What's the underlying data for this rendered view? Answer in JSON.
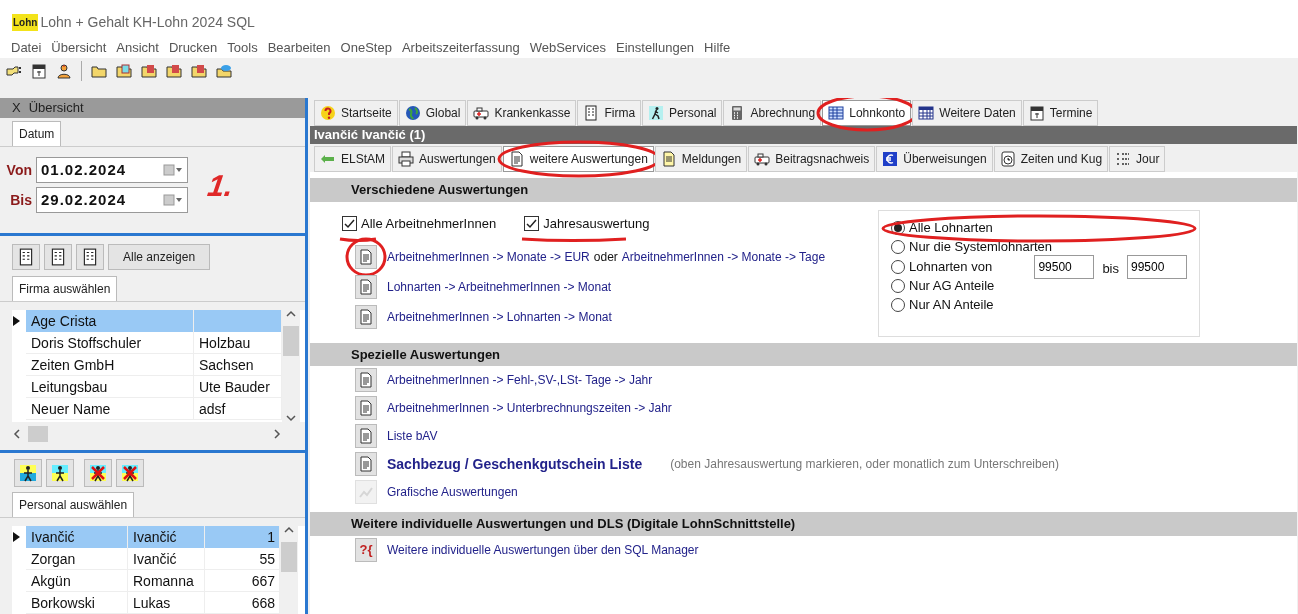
{
  "window": {
    "logo": "Lohn",
    "title": "Lohn + Gehalt KH-Lohn 2024 SQL"
  },
  "menu": [
    "Datei",
    "Übersicht",
    "Ansicht",
    "Drucken",
    "Tools",
    "Bearbeiten",
    "OneStep",
    "Arbeitszeiterfassung",
    "WebServices",
    "Einstellungen",
    "Hilfe"
  ],
  "left_panel": {
    "header": {
      "close": "X",
      "title": "Übersicht"
    },
    "date_tab": {
      "label": "Datum",
      "selected": true
    },
    "from": {
      "label": "Von",
      "value": "01.02.2024"
    },
    "to": {
      "label": "Bis",
      "value": "29.02.2024"
    },
    "annotation": "1.",
    "show_all_button": "Alle anzeigen",
    "company_tab": {
      "label": "Firma auswählen",
      "selected": true
    },
    "company_rows": [
      {
        "name": "Age Crista",
        "column_2": "",
        "selected": true
      },
      {
        "name": "Doris Stoffschuler",
        "column_2": "Holzbau",
        "selected": false
      },
      {
        "name": "Zeiten GmbH",
        "column_2": "Sachsen",
        "selected": false
      },
      {
        "name": "Leitungsbau",
        "column_2": "Ute Bauder",
        "selected": false
      },
      {
        "name": "Neuer Name",
        "column_2": "adsf",
        "selected": false
      }
    ],
    "person_tab": {
      "label": "Personal auswählen",
      "selected": true
    },
    "person_rows": [
      {
        "name": "Ivančić",
        "column_2": "Ivančić",
        "column_3": "1",
        "selected": true
      },
      {
        "name": "Zorgan",
        "column_2": "Ivančić",
        "column_3": "55",
        "selected": false
      },
      {
        "name": "Akgün",
        "column_2": "Romanna",
        "column_3": "667",
        "selected": false
      },
      {
        "name": "Borkowski",
        "column_2": "Lukas",
        "column_3": "668",
        "selected": false
      }
    ]
  },
  "top_tabs": [
    {
      "label": "Startseite",
      "kind": "help",
      "selected": false,
      "circled": false
    },
    {
      "label": "Global",
      "kind": "globe",
      "selected": false,
      "circled": false
    },
    {
      "label": "Krankenkasse",
      "kind": "ambulance",
      "selected": false,
      "circled": false
    },
    {
      "label": "Firma",
      "kind": "building",
      "selected": false,
      "circled": false
    },
    {
      "label": "Personal",
      "kind": "walker",
      "selected": false,
      "circled": false
    },
    {
      "label": "Abrechnung",
      "kind": "calculator",
      "selected": false,
      "circled": false
    },
    {
      "label": "Lohnkonto",
      "kind": "table",
      "selected": true,
      "circled": true
    },
    {
      "label": "Weitere Daten",
      "kind": "grid",
      "selected": false,
      "circled": false
    },
    {
      "label": "Termine",
      "kind": "calendar",
      "selected": false,
      "circled": false
    }
  ],
  "employee_header": "Ivančić Ivančić (1)",
  "sub_tabs": [
    {
      "label": "ELStAM",
      "kind": "arrows",
      "selected": false,
      "circled": false
    },
    {
      "label": "Auswertungen",
      "kind": "printer",
      "selected": false,
      "circled": false
    },
    {
      "label": "weitere Auswertungen",
      "kind": "document",
      "selected": true,
      "circled": true
    },
    {
      "label": "Meldungen",
      "kind": "note",
      "selected": false,
      "circled": false
    },
    {
      "label": "Beitragsnachweis",
      "kind": "ambulance",
      "selected": false,
      "circled": false
    },
    {
      "label": "Überweisungen",
      "kind": "money",
      "selected": false,
      "circled": false
    },
    {
      "label": "Zeiten und Kug",
      "kind": "clock",
      "selected": false,
      "circled": false
    },
    {
      "label": "Jour",
      "kind": "list",
      "selected": false,
      "circled": false
    }
  ],
  "sections": [
    {
      "title": "Verschiedene Auswertungen",
      "checkboxes": [
        {
          "label": "Alle ArbeitnehmerInnen",
          "checked": true,
          "underlined": true
        },
        {
          "label": "Jahresauswertung",
          "checked": true,
          "underlined": true
        }
      ],
      "reports": [
        {
          "kind": "document",
          "circled": true,
          "parts": [
            {
              "text": "ArbeitnehmerInnen -> Monate -> EUR",
              "kind": "link"
            },
            {
              "text": "oder",
              "kind": "plain"
            },
            {
              "text": "ArbeitnehmerInnen -> Monate -> Tage",
              "kind": "link"
            }
          ]
        },
        {
          "kind": "document",
          "circled": false,
          "parts": [
            {
              "text": "Lohnarten -> ArbeitnehmerInnen -> Monat",
              "kind": "link"
            }
          ]
        },
        {
          "kind": "document",
          "circled": false,
          "parts": [
            {
              "text": "ArbeitnehmerInnen -> Lohnarten -> Monat",
              "kind": "link"
            }
          ]
        }
      ],
      "radio_options": [
        {
          "label": "Alle Lohnarten",
          "selected": true,
          "circled": true
        },
        {
          "label": "Nur die Systemlohnarten",
          "selected": false,
          "circled": false
        },
        {
          "label": "Lohnarten von",
          "selected": false,
          "circled": false,
          "range": {
            "from": "99500",
            "joiner": "bis",
            "to": "99500"
          }
        },
        {
          "label": "Nur AG Anteile",
          "selected": false,
          "circled": false
        },
        {
          "label": "Nur AN Anteile",
          "selected": false,
          "circled": false
        }
      ]
    },
    {
      "title": "Spezielle Auswertungen",
      "reports": [
        {
          "kind": "document",
          "circled": false,
          "parts": [
            {
              "text": "ArbeitnehmerInnen -> Fehl-,SV-,LSt- Tage -> Jahr",
              "kind": "link"
            }
          ]
        },
        {
          "kind": "document",
          "circled": false,
          "parts": [
            {
              "text": "ArbeitnehmerInnen -> Unterbrechnungszeiten -> Jahr",
              "kind": "link"
            }
          ]
        },
        {
          "kind": "document",
          "circled": false,
          "parts": [
            {
              "text": "Liste bAV",
              "kind": "link"
            }
          ]
        },
        {
          "kind": "document",
          "circled": false,
          "parts": [
            {
              "text": "Sachbezug / Geschenkgutschein Liste",
              "kind": "strong"
            },
            {
              "text": "(oben Jahresauswertung markieren, oder monatlich zum Unterschreiben)",
              "kind": "note"
            }
          ]
        },
        {
          "kind": "chart",
          "circled": false,
          "parts": [
            {
              "text": "Grafische Auswertungen",
              "kind": "link"
            }
          ]
        }
      ]
    },
    {
      "title": "Weitere individuelle Auswertungen und DLS  (Digitale LohnSchnittstelle)",
      "reports": [
        {
          "kind": "sql",
          "icon_text": "?{",
          "circled": false,
          "parts": [
            {
              "text": "Weitere individuelle Auswertungen über den SQL Manager",
              "kind": "link"
            }
          ]
        }
      ]
    }
  ]
}
